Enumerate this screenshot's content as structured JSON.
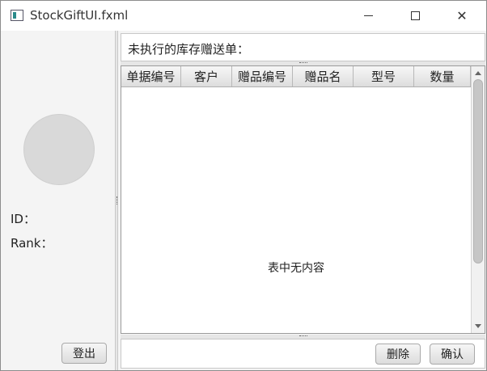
{
  "window": {
    "title": "StockGiftUI.fxml",
    "close_glyph": "✕"
  },
  "left": {
    "id_label": "ID：",
    "rank_label": "Rank：",
    "logout_label": "登出"
  },
  "right": {
    "pending_label": "未执行的库存赠送单：",
    "columns": [
      "单据编号",
      "客户",
      "赠品编号",
      "赠品名",
      "型号",
      "数量"
    ],
    "empty_message": "表中无内容",
    "delete_label": "删除",
    "confirm_label": "确认"
  }
}
